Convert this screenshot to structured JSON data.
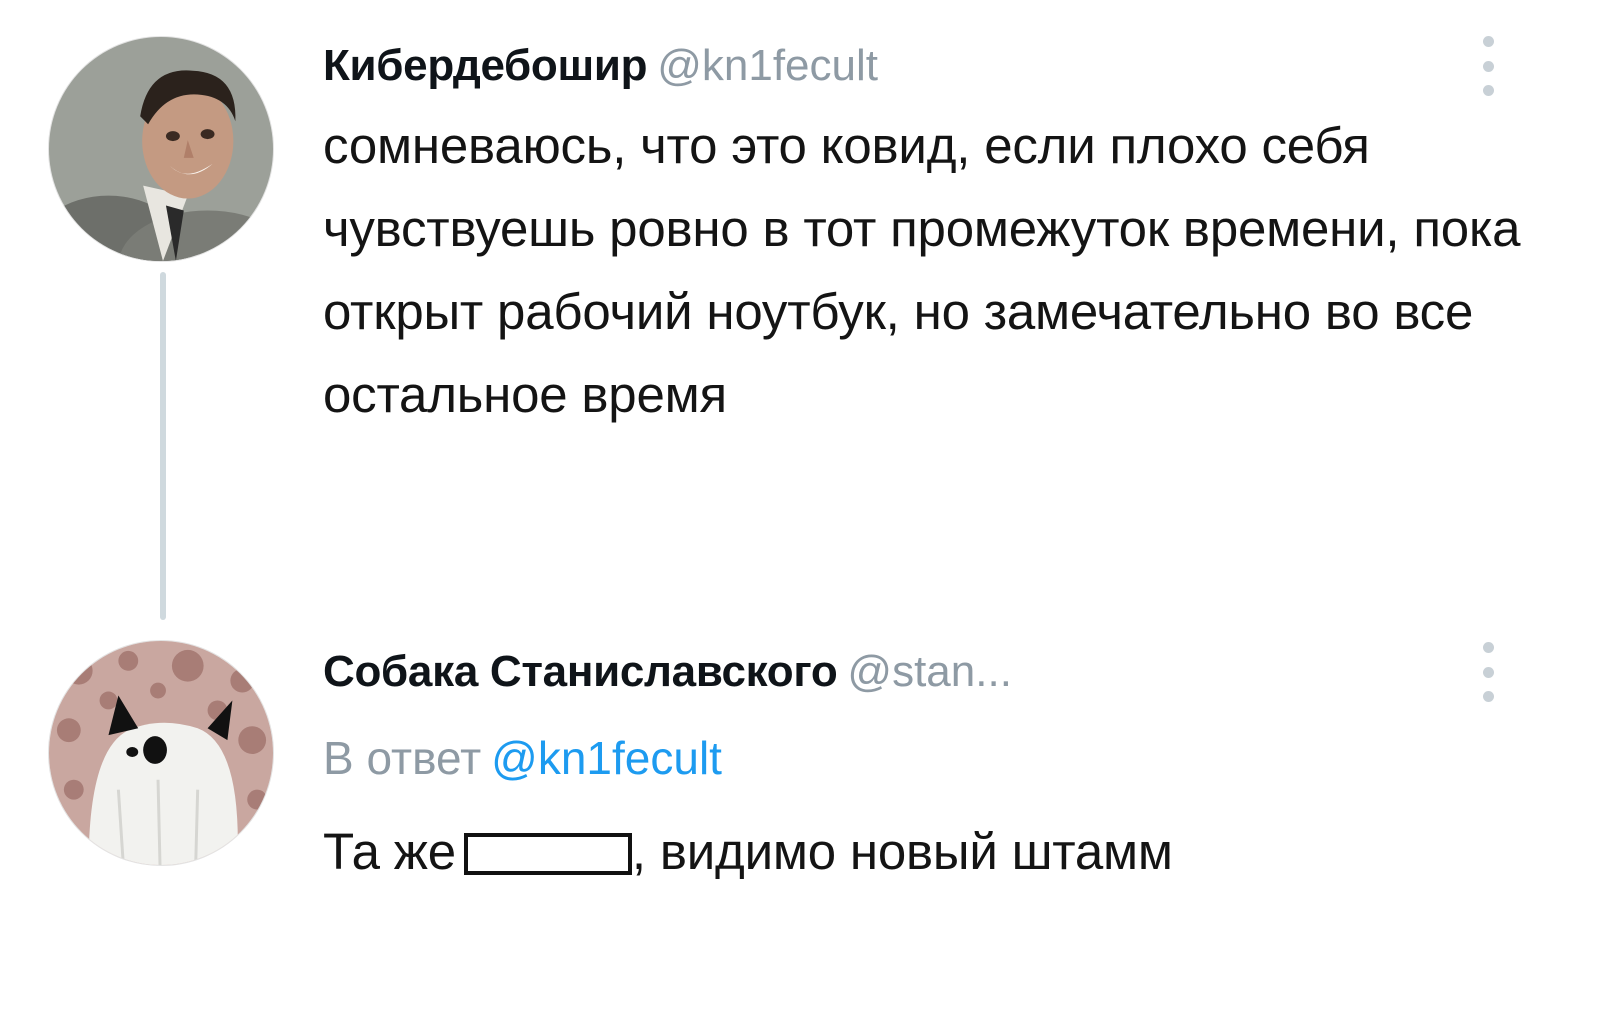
{
  "tweets": [
    {
      "author_name": "Кибердебошир",
      "author_handle": "@kn1fecult",
      "text": "сомневаюсь, что это ковид, если плохо себя чувствуешь ровно в тот промежуток времени, пока открыт рабочий ноутбук, но замечательно во все остальное время",
      "avatar_icon": "man-smiling-avatar",
      "menu_icon": "vertical-dots-icon"
    },
    {
      "author_name": "Собака Станиславского",
      "author_handle": "@stan...",
      "reply_prefix": "В ответ",
      "reply_handle": "@kn1fecult",
      "text_before": "Та же",
      "text_after": ", видимо новый штамм",
      "avatar_icon": "ghost-costume-avatar",
      "menu_icon": "vertical-dots-icon"
    }
  ],
  "colors": {
    "handle_gray": "#8e9aa4",
    "link_blue": "#1d9bf0",
    "thread_line": "#cfd9de"
  }
}
